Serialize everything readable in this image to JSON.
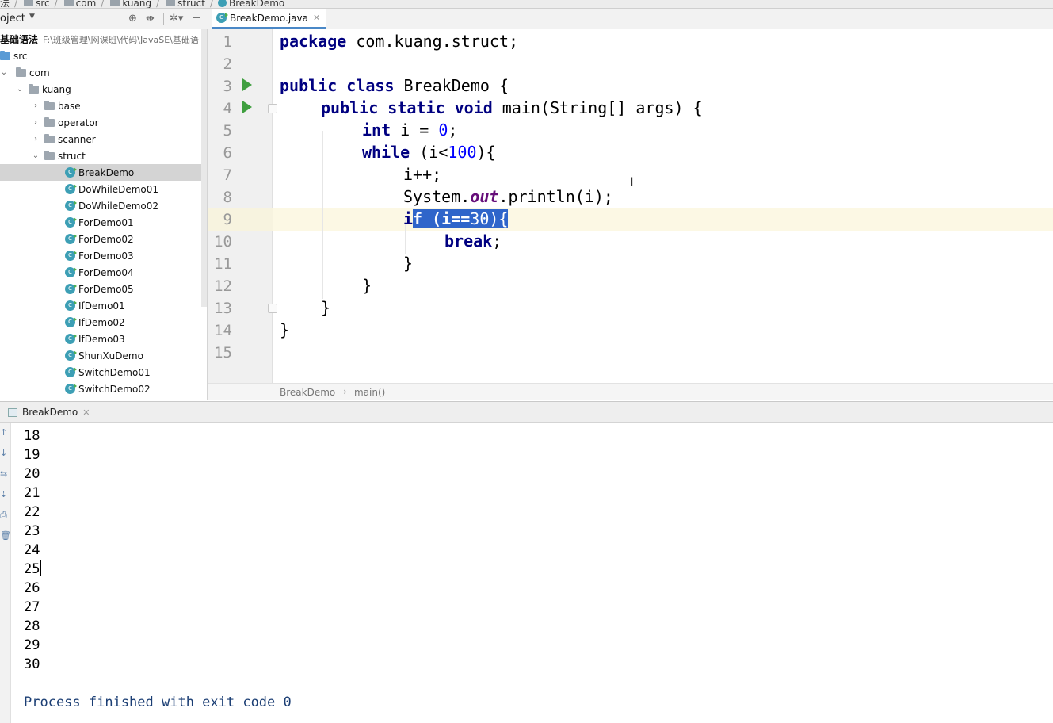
{
  "breadcrumb": [
    "法",
    "src",
    "com",
    "kuang",
    "struct",
    "BreakDemo"
  ],
  "project_panel": {
    "title": "oject",
    "tree": [
      {
        "label": "基础语法",
        "path": "F:\\班级管理\\网课班\\代码\\JavaSE\\基础语",
        "kind": "module"
      },
      {
        "label": "src",
        "kind": "src-folder"
      },
      {
        "label": "com",
        "kind": "package",
        "expanded": true
      },
      {
        "label": "kuang",
        "kind": "package",
        "expanded": true
      },
      {
        "label": "base",
        "kind": "package",
        "expanded": false
      },
      {
        "label": "operator",
        "kind": "package",
        "expanded": false
      },
      {
        "label": "scanner",
        "kind": "package",
        "expanded": false
      },
      {
        "label": "struct",
        "kind": "package",
        "expanded": true
      },
      {
        "label": "BreakDemo",
        "kind": "class",
        "selected": true
      },
      {
        "label": "DoWhileDemo01",
        "kind": "class"
      },
      {
        "label": "DoWhileDemo02",
        "kind": "class"
      },
      {
        "label": "ForDemo01",
        "kind": "class"
      },
      {
        "label": "ForDemo02",
        "kind": "class"
      },
      {
        "label": "ForDemo03",
        "kind": "class"
      },
      {
        "label": "ForDemo04",
        "kind": "class"
      },
      {
        "label": "ForDemo05",
        "kind": "class"
      },
      {
        "label": "IfDemo01",
        "kind": "class"
      },
      {
        "label": "IfDemo02",
        "kind": "class"
      },
      {
        "label": "IfDemo03",
        "kind": "class"
      },
      {
        "label": "ShunXuDemo",
        "kind": "class"
      },
      {
        "label": "SwitchDemo01",
        "kind": "class"
      },
      {
        "label": "SwitchDemo02",
        "kind": "class"
      }
    ]
  },
  "editor": {
    "tab_label": "BreakDemo.java",
    "line_numbers": [
      "1",
      "2",
      "3",
      "4",
      "5",
      "6",
      "7",
      "8",
      "9",
      "10",
      "11",
      "12",
      "13",
      "14",
      "15"
    ],
    "code": {
      "l1_kw": "package",
      "l1_rest": " com.kuang.struct;",
      "l3_kw": "public class",
      "l3_rest": " BreakDemo {",
      "l4_kw": "public static void",
      "l4_rest": " main(String[] args) {",
      "l5_kw": "int",
      "l5_mid": " i = ",
      "l5_num": "0",
      "l5_end": ";",
      "l6_kw": "while",
      "l6_mid": " (i<",
      "l6_num": "100",
      "l6_end": "){",
      "l7": "i++;",
      "l8_a": "System.",
      "l8_fld": "out",
      "l8_b": ".println(i);",
      "l9_pre": "i",
      "l9_sel_a": "f (i==",
      "l9_sel_num": "30",
      "l9_sel_b": "){",
      "l10_kw": "break",
      "l10_end": ";",
      "l11": "}",
      "l12": "}",
      "l13": "}",
      "l14": "}"
    },
    "breadcrumb": [
      "BreakDemo",
      "main()"
    ]
  },
  "run_panel": {
    "tab_label": "BreakDemo",
    "output": [
      "18",
      "19",
      "20",
      "21",
      "22",
      "23",
      "24",
      "25",
      "26",
      "27",
      "28",
      "29",
      "30"
    ],
    "exit_message": "Process finished with exit code 0"
  }
}
